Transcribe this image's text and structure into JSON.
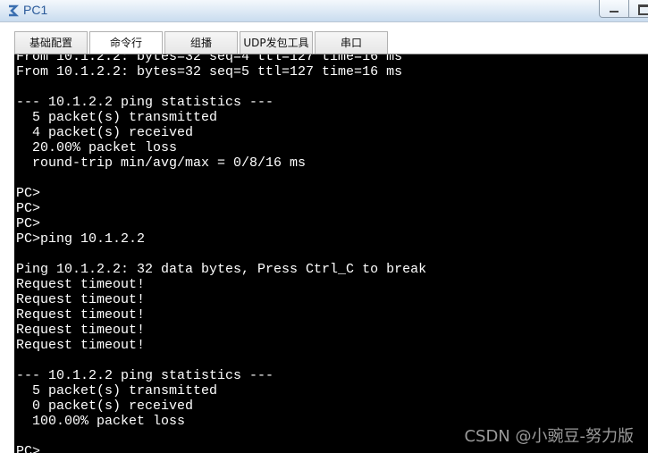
{
  "window": {
    "title": "PC1",
    "icon": "network-pc-icon"
  },
  "tabs": [
    {
      "label": "基础配置",
      "active": false
    },
    {
      "label": "命令行",
      "active": true
    },
    {
      "label": "组播",
      "active": false
    },
    {
      "label": "UDP发包工具",
      "active": false
    },
    {
      "label": "串口",
      "active": false
    }
  ],
  "terminal": {
    "lines": [
      "From 10.1.2.2: bytes=32 seq=4 ttl=127 time=16 ms",
      "From 10.1.2.2: bytes=32 seq=5 ttl=127 time=16 ms",
      "",
      "--- 10.1.2.2 ping statistics ---",
      "  5 packet(s) transmitted",
      "  4 packet(s) received",
      "  20.00% packet loss",
      "  round-trip min/avg/max = 0/8/16 ms",
      "",
      "PC>",
      "PC>",
      "PC>",
      "PC>ping 10.1.2.2",
      "",
      "Ping 10.1.2.2: 32 data bytes, Press Ctrl_C to break",
      "Request timeout!",
      "Request timeout!",
      "Request timeout!",
      "Request timeout!",
      "Request timeout!",
      "",
      "--- 10.1.2.2 ping statistics ---",
      "  5 packet(s) transmitted",
      "  0 packet(s) received",
      "  100.00% packet loss",
      "",
      "PC>"
    ]
  },
  "watermark": "CSDN @小豌豆-努力版"
}
